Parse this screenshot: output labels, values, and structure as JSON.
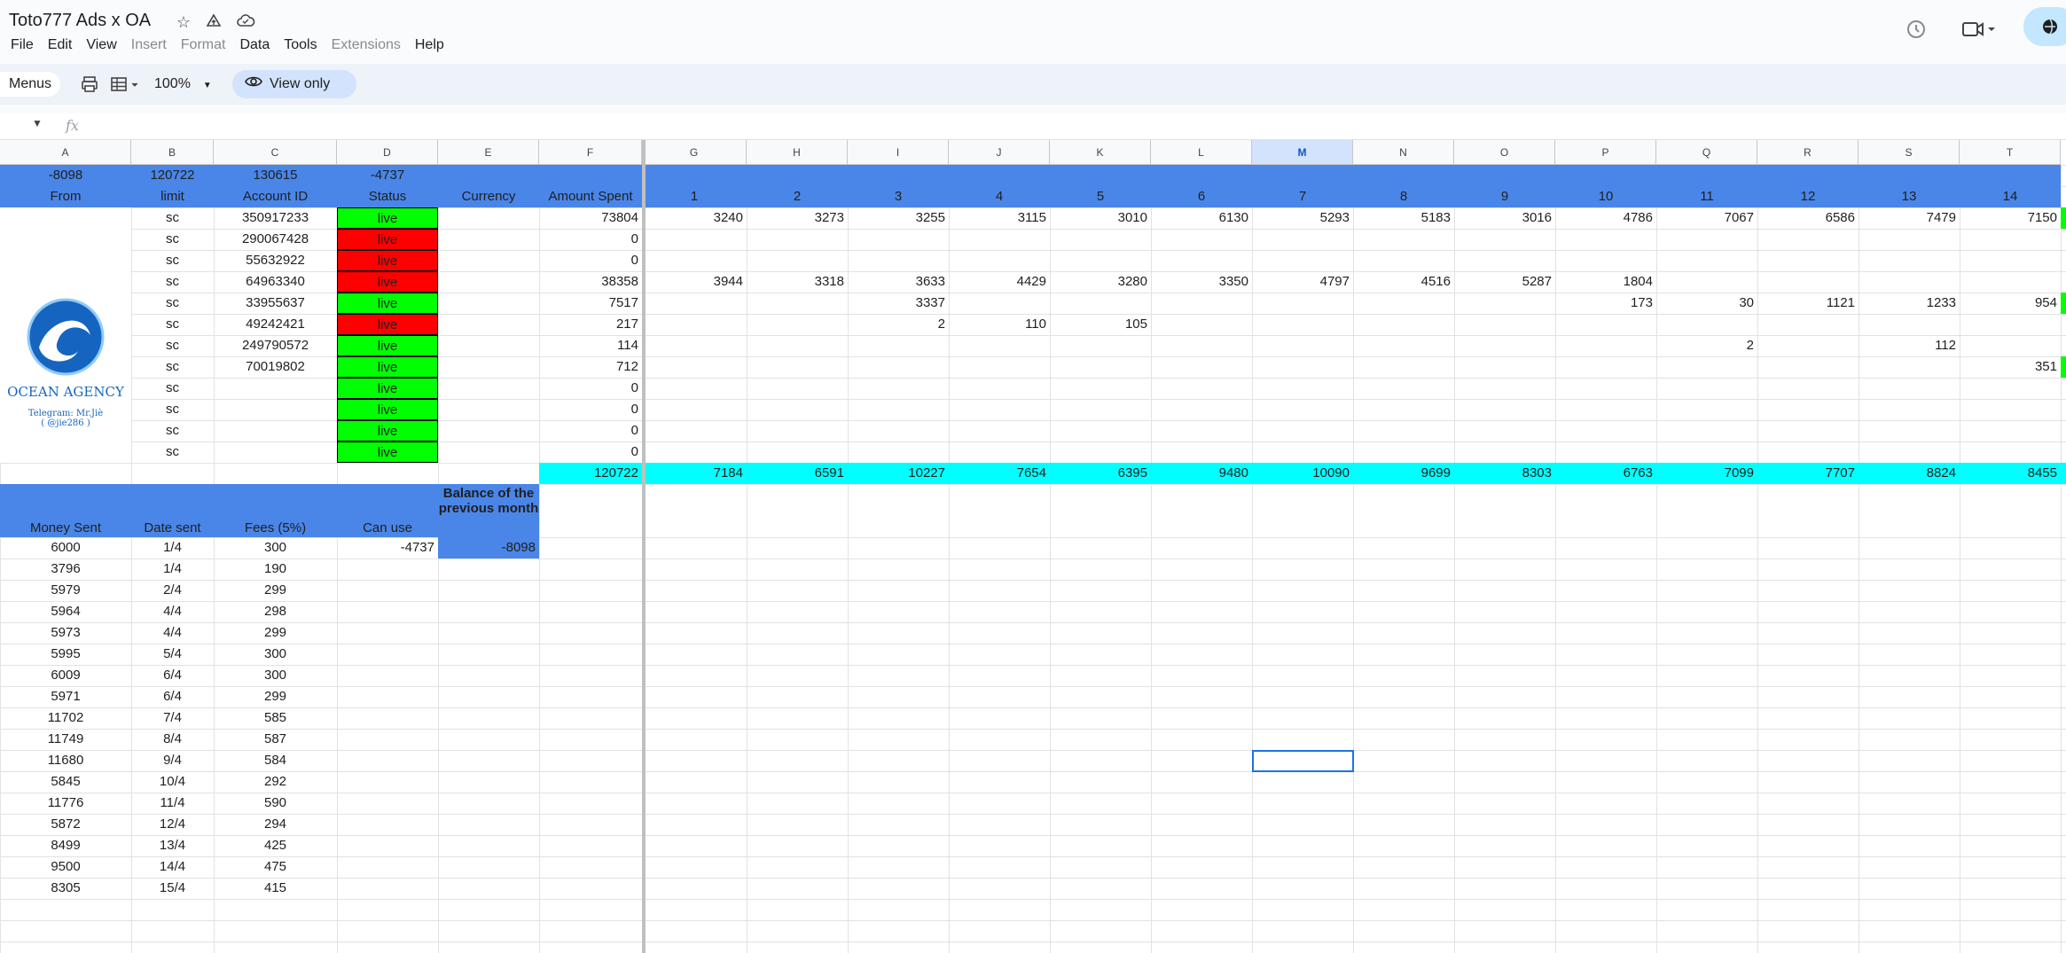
{
  "app": {
    "title": "Toto777 Ads x OA",
    "menu": [
      "File",
      "Edit",
      "View",
      "Insert",
      "Format",
      "Data",
      "Tools",
      "Extensions",
      "Help"
    ],
    "menu_disabled": [
      "Insert",
      "Format",
      "Extensions"
    ]
  },
  "toolbar": {
    "menus_label": "Menus",
    "zoom": "100%",
    "view_only": "View only"
  },
  "formula": {
    "fx": "fx"
  },
  "columns": [
    "A",
    "B",
    "C",
    "D",
    "E",
    "F",
    "G",
    "H",
    "I",
    "J",
    "K",
    "L",
    "M",
    "N",
    "O",
    "P",
    "Q",
    "R",
    "S",
    "T"
  ],
  "selected_column": "M",
  "row1": [
    "-8098",
    "120722",
    "130615",
    "-4737"
  ],
  "header": {
    "from": "From",
    "limit": "limit",
    "account": "Account ID",
    "status": "Status",
    "currency": "Currency",
    "amount": "Amount Spent",
    "days": [
      "1",
      "2",
      "3",
      "4",
      "5",
      "6",
      "7",
      "8",
      "9",
      "10",
      "11",
      "12",
      "13",
      "14"
    ]
  },
  "logo": {
    "name": "OCEAN AGENCY",
    "tg1": "Telegram: Mr.Jiè",
    "tg2": "( @jie286 )"
  },
  "accounts": [
    {
      "limit": "sc",
      "id": "350917233",
      "status": "live",
      "ok": true,
      "amount": "73804",
      "days": [
        "3240",
        "3273",
        "3255",
        "3115",
        "3010",
        "6130",
        "5293",
        "5183",
        "3016",
        "4786",
        "7067",
        "6586",
        "7479",
        "7150"
      ]
    },
    {
      "limit": "sc",
      "id": "290067428",
      "status": "live",
      "ok": false,
      "amount": "0",
      "days": [
        "",
        "",
        "",
        "",
        "",
        "",
        "",
        "",
        "",
        "",
        "",
        "",
        "",
        ""
      ]
    },
    {
      "limit": "sc",
      "id": "55632922",
      "status": "live",
      "ok": false,
      "amount": "0",
      "days": [
        "",
        "",
        "",
        "",
        "",
        "",
        "",
        "",
        "",
        "",
        "",
        "",
        "",
        ""
      ]
    },
    {
      "limit": "sc",
      "id": "64963340",
      "status": "live",
      "ok": false,
      "amount": "38358",
      "days": [
        "3944",
        "3318",
        "3633",
        "4429",
        "3280",
        "3350",
        "4797",
        "4516",
        "5287",
        "1804",
        "",
        "",
        "",
        ""
      ]
    },
    {
      "limit": "sc",
      "id": "33955637",
      "status": "live",
      "ok": true,
      "amount": "7517",
      "days": [
        "",
        "",
        "3337",
        "",
        "",
        "",
        "",
        "",
        "",
        "173",
        "30",
        "1121",
        "1233",
        "954"
      ]
    },
    {
      "limit": "sc",
      "id": "49242421",
      "status": "live",
      "ok": false,
      "amount": "217",
      "days": [
        "",
        "",
        "2",
        "110",
        "105",
        "",
        "",
        "",
        "",
        "",
        "",
        "",
        "",
        ""
      ]
    },
    {
      "limit": "sc",
      "id": "249790572",
      "status": "live",
      "ok": true,
      "amount": "114",
      "days": [
        "",
        "",
        "",
        "",
        "",
        "",
        "",
        "",
        "",
        "",
        "2",
        "",
        "112",
        ""
      ]
    },
    {
      "limit": "sc",
      "id": "70019802",
      "status": "live",
      "ok": true,
      "amount": "712",
      "days": [
        "",
        "",
        "",
        "",
        "",
        "",
        "",
        "",
        "",
        "",
        "",
        "",
        "",
        "351"
      ]
    },
    {
      "limit": "sc",
      "id": "",
      "status": "live",
      "ok": true,
      "amount": "0",
      "days": [
        "",
        "",
        "",
        "",
        "",
        "",
        "",
        "",
        "",
        "",
        "",
        "",
        "",
        ""
      ]
    },
    {
      "limit": "sc",
      "id": "",
      "status": "live",
      "ok": true,
      "amount": "0",
      "days": [
        "",
        "",
        "",
        "",
        "",
        "",
        "",
        "",
        "",
        "",
        "",
        "",
        "",
        ""
      ]
    },
    {
      "limit": "sc",
      "id": "",
      "status": "live",
      "ok": true,
      "amount": "0",
      "days": [
        "",
        "",
        "",
        "",
        "",
        "",
        "",
        "",
        "",
        "",
        "",
        "",
        "",
        ""
      ]
    },
    {
      "limit": "sc",
      "id": "",
      "status": "live",
      "ok": true,
      "amount": "0",
      "days": [
        "",
        "",
        "",
        "",
        "",
        "",
        "",
        "",
        "",
        "",
        "",
        "",
        "",
        ""
      ]
    }
  ],
  "totals": {
    "amount": "120722",
    "days": [
      "7184",
      "6591",
      "10227",
      "7654",
      "6395",
      "9480",
      "10090",
      "9699",
      "8303",
      "6763",
      "7099",
      "7707",
      "8824",
      "8455"
    ]
  },
  "payments_header": {
    "money": "Money Sent",
    "date": "Date sent",
    "fees": "Fees (5%)",
    "canuse": "Can use",
    "balance": "Balance of the previous month"
  },
  "payments_first": {
    "canuse": "-4737",
    "balance": "-8098"
  },
  "payments": [
    {
      "money": "6000",
      "date": "1/4",
      "fees": "300"
    },
    {
      "money": "3796",
      "date": "1/4",
      "fees": "190"
    },
    {
      "money": "5979",
      "date": "2/4",
      "fees": "299"
    },
    {
      "money": "5964",
      "date": "4/4",
      "fees": "298"
    },
    {
      "money": "5973",
      "date": "4/4",
      "fees": "299"
    },
    {
      "money": "5995",
      "date": "5/4",
      "fees": "300"
    },
    {
      "money": "6009",
      "date": "6/4",
      "fees": "300"
    },
    {
      "money": "5971",
      "date": "6/4",
      "fees": "299"
    },
    {
      "money": "11702",
      "date": "7/4",
      "fees": "585"
    },
    {
      "money": "11749",
      "date": "8/4",
      "fees": "587"
    },
    {
      "money": "11680",
      "date": "9/4",
      "fees": "584"
    },
    {
      "money": "5845",
      "date": "10/4",
      "fees": "292"
    },
    {
      "money": "11776",
      "date": "11/4",
      "fees": "590"
    },
    {
      "money": "5872",
      "date": "12/4",
      "fees": "294"
    },
    {
      "money": "8499",
      "date": "13/4",
      "fees": "425"
    },
    {
      "money": "9500",
      "date": "14/4",
      "fees": "475"
    },
    {
      "money": "8305",
      "date": "15/4",
      "fees": "415"
    }
  ],
  "colors": {
    "header_blue": "#4a86e8",
    "total_cyan": "#00ffff",
    "live_green": "#00ff00",
    "dead_red": "#ff0000"
  }
}
